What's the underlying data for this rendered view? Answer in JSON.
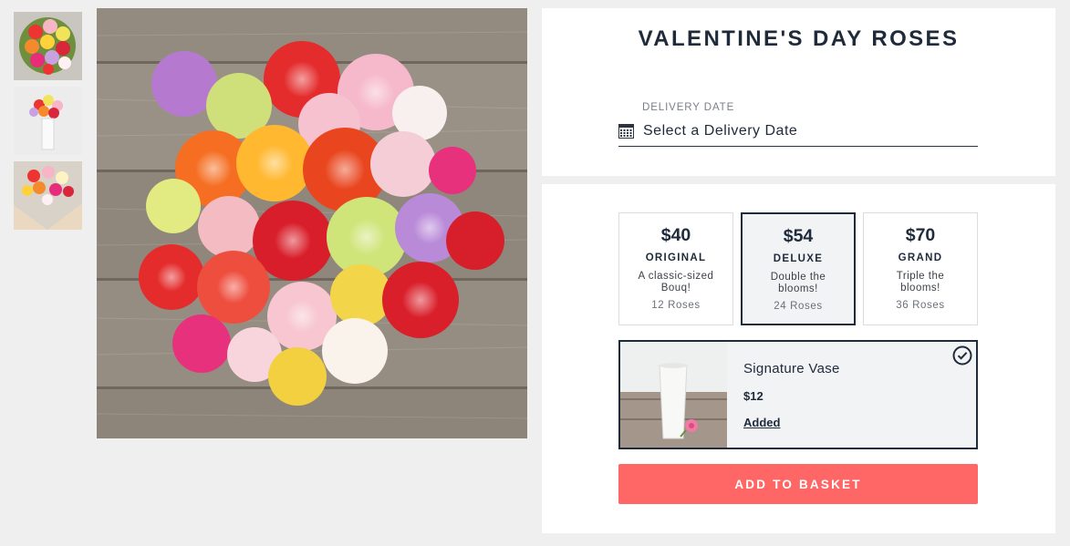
{
  "product": {
    "title": "VALENTINE'S DAY ROSES"
  },
  "delivery": {
    "label": "DELIVERY DATE",
    "value": "Select a Delivery Date",
    "icon": "calendar-icon"
  },
  "sizes": [
    {
      "price": "$40",
      "name": "ORIGINAL",
      "description": "A classic-sized Bouq!",
      "count": "12 Roses",
      "selected": false
    },
    {
      "price": "$54",
      "name": "DELUXE",
      "description": "Double the blooms!",
      "count": "24 Roses",
      "selected": true
    },
    {
      "price": "$70",
      "name": "GRAND",
      "description": "Triple the blooms!",
      "count": "36 Roses",
      "selected": false
    }
  ],
  "addon": {
    "name": "Signature Vase",
    "price": "$12",
    "status": "Added",
    "icon": "check-circle-icon"
  },
  "cta": {
    "label": "ADD TO BASKET",
    "color": "#ff6666"
  },
  "colors": {
    "navy": "#1f2a3a",
    "background": "#efefef"
  }
}
